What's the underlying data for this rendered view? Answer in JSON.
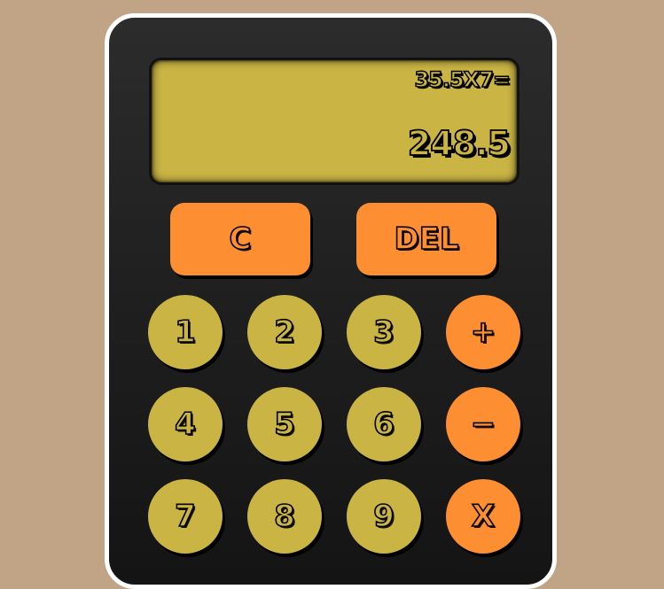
{
  "display": {
    "expression": "35.5X7=",
    "result": "248.5"
  },
  "controls": {
    "clear_label": "C",
    "delete_label": "DEL"
  },
  "keys": {
    "one": "1",
    "two": "2",
    "three": "3",
    "plus": "+",
    "four": "4",
    "five": "5",
    "six": "6",
    "minus": "−",
    "seven": "7",
    "eight": "8",
    "nine": "9",
    "multiply": "X"
  },
  "colors": {
    "background": "#c1a386",
    "body": "#1f1f1f",
    "display": "#c9b444",
    "number_key": "#c9b444",
    "operator_key": "#fd8e31"
  }
}
